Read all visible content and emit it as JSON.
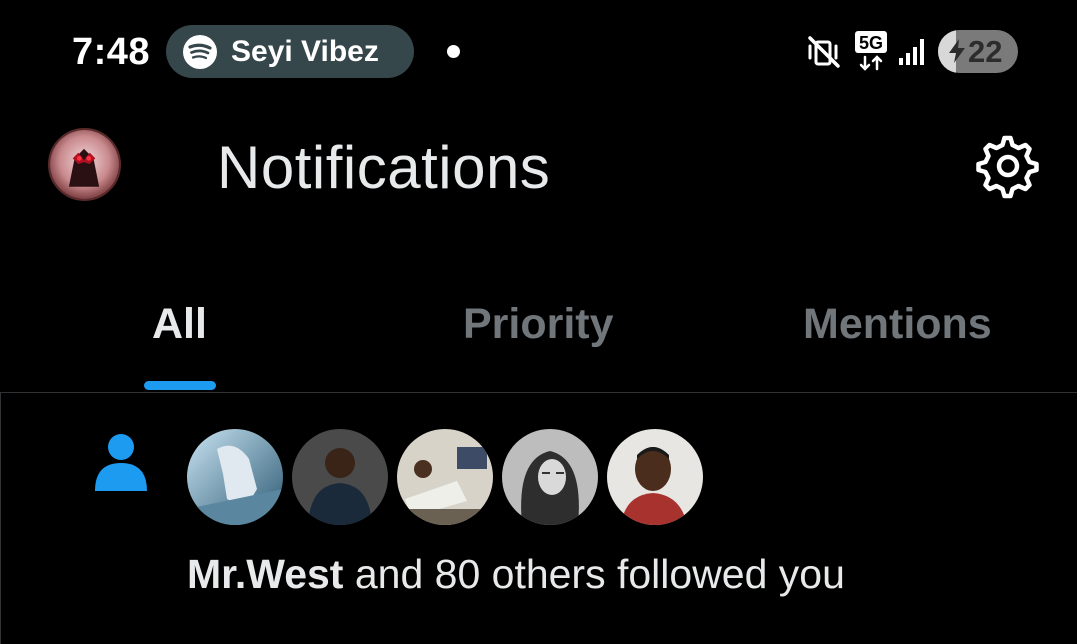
{
  "status_bar": {
    "time": "7:48",
    "media_app_icon": "spotify-icon",
    "media_title": "Seyi Vibez",
    "network": "5G",
    "icons": [
      "vibrate-mute-icon",
      "5g-data-icon",
      "signal-icon",
      "battery-icon"
    ],
    "battery_level": "22",
    "battery_fraction": 0.22
  },
  "header": {
    "title": "Notifications",
    "avatar_icon": "profile-avatar",
    "settings_icon": "gear-icon"
  },
  "tabs": [
    {
      "label": "All",
      "active": true
    },
    {
      "label": "Priority",
      "active": false
    },
    {
      "label": "Mentions",
      "active": false
    }
  ],
  "notification": {
    "type_icon": "person-icon",
    "follower_name": "Mr.West",
    "text": " and 80 others followed you",
    "avatars_count": 5
  },
  "colors": {
    "background": "#000000",
    "accent": "#1d9bf0",
    "text_primary": "#e7e9ea",
    "text_secondary": "#71767b",
    "divider": "#2f3336",
    "media_pill": "#36474b"
  }
}
